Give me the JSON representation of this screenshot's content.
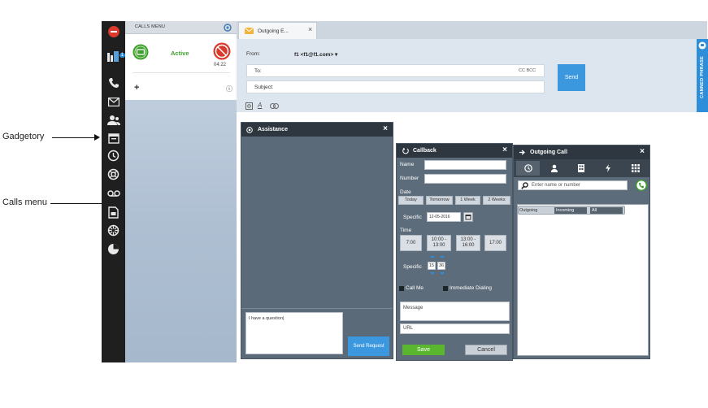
{
  "annotations": {
    "gadgetory": "Gadgetory",
    "calls_menu": "Calls menu"
  },
  "icon_bar": {
    "items": [
      {
        "icon": "logout-icon"
      },
      {
        "icon": "calls-menu-icon",
        "badge": "1"
      },
      {
        "icon": "phone-icon"
      },
      {
        "icon": "email-icon"
      },
      {
        "icon": "contacts-icon"
      },
      {
        "icon": "gadgetory-icon"
      },
      {
        "icon": "history-icon"
      },
      {
        "icon": "help-icon"
      },
      {
        "icon": "voicemail-icon"
      },
      {
        "icon": "document-icon"
      },
      {
        "icon": "settings-icon"
      },
      {
        "icon": "chart-icon"
      }
    ]
  },
  "calls_menu": {
    "title": "CALLS MENU",
    "status": "Active",
    "timer": "04:22",
    "add_symbol": "+",
    "info_symbol": "ⓘ"
  },
  "email": {
    "tab_label": "Outgoing E...",
    "tab_close": "×",
    "from_label": "From:",
    "from_value": "f1 <f1@f1.com> ▾",
    "to_label": "To:",
    "cc_bcc": "CC BCC",
    "subject_label": "Subject:",
    "send_label": "Send",
    "side_widget_text": "CANNED PHRASE"
  },
  "assistance": {
    "title": "Assistance",
    "close": "×",
    "question_text": "I have a question|",
    "send_request_label": "Send Request"
  },
  "callback": {
    "title": "Callback",
    "close": "×",
    "name_label": "Name",
    "number_label": "Number",
    "date_label": "Date",
    "date_options": [
      "Today",
      "Tomorrow",
      "1 Week",
      "2 Weeks"
    ],
    "specific_label": "Specific",
    "specific_date": "12-05-2016",
    "time_label": "Time",
    "time_options": [
      "7:00",
      "10:00 - 13:00",
      "13:00 - 16:00",
      "17:00"
    ],
    "specific_time_label": "Specific",
    "specific_hour": "15",
    "specific_minute": "36",
    "call_me_label": "Call Me",
    "immediate_label": "Immediate Dialing",
    "message_placeholder": "Message",
    "url_placeholder": "URL",
    "save_label": "Save",
    "cancel_label": "Cancel"
  },
  "outgoing_call": {
    "title": "Outgoing Call",
    "close": "×",
    "tabs": [
      {
        "icon": "clock-icon"
      },
      {
        "icon": "person-icon"
      },
      {
        "icon": "building-icon"
      },
      {
        "icon": "lightning-icon"
      },
      {
        "icon": "keypad-icon"
      }
    ],
    "search_placeholder": "Enter name or number",
    "filters": [
      "Outgoing",
      "Incoming",
      "All"
    ]
  },
  "colors": {
    "icon_bar": "#1f1f1f",
    "accent_blue": "#3b97de",
    "save_green": "#5bb62f",
    "active_green": "#3ea02c",
    "hangup_red": "#d93a2b",
    "dialog_header": "#2e3740"
  }
}
